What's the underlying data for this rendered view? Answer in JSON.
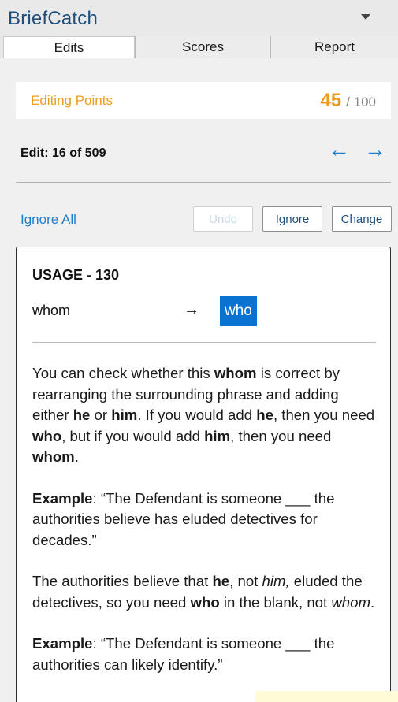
{
  "app": {
    "title": "BriefCatch"
  },
  "tabs": [
    {
      "label": "Edits",
      "active": true
    },
    {
      "label": "Scores",
      "active": false
    },
    {
      "label": "Report",
      "active": false
    }
  ],
  "points": {
    "label": "Editing Points",
    "current": "45",
    "total_text": "/ 100"
  },
  "edit_nav": {
    "counter": "Edit: 16 of 509",
    "prev_arrow": "←",
    "next_arrow": "→"
  },
  "actions": {
    "ignore_all": "Ignore All",
    "undo": "Undo",
    "ignore": "Ignore",
    "change": "Change"
  },
  "suggestion": {
    "rule": "USAGE - 130",
    "original": "whom",
    "arrow": "→",
    "replacement": "who",
    "paragraphs": [
      [
        {
          "t": "You can check whether this "
        },
        {
          "t": "whom",
          "b": true
        },
        {
          "t": " is correct by rearranging the surrounding phrase and adding either "
        },
        {
          "t": "he",
          "b": true
        },
        {
          "t": " or "
        },
        {
          "t": "him",
          "b": true
        },
        {
          "t": ". If you would add "
        },
        {
          "t": "he",
          "b": true
        },
        {
          "t": ", then you need "
        },
        {
          "t": "who",
          "b": true
        },
        {
          "t": ", but if you would add "
        },
        {
          "t": "him",
          "b": true
        },
        {
          "t": ", then you need "
        },
        {
          "t": "whom",
          "b": true
        },
        {
          "t": "."
        }
      ],
      [
        {
          "t": "Example",
          "b": true
        },
        {
          "t": ": “The Defendant is someone ___ the authorities believe has eluded detectives for decades.”"
        }
      ],
      [
        {
          "t": "The authorities believe that "
        },
        {
          "t": "he",
          "b": true
        },
        {
          "t": ", not "
        },
        {
          "t": "him,",
          "i": true
        },
        {
          "t": " eluded the detectives, so you need "
        },
        {
          "t": "who",
          "b": true
        },
        {
          "t": " in the blank, not "
        },
        {
          "t": "whom",
          "i": true
        },
        {
          "t": "."
        }
      ],
      [
        {
          "t": "Example",
          "b": true
        },
        {
          "t": ": “The Defendant is someone ___ the authorities can likely identify.”"
        }
      ]
    ]
  },
  "colors": {
    "accent_orange": "#ef9a1c",
    "link_blue": "#1f7fcf",
    "highlight_blue": "#0a73d1",
    "title_blue": "#1f4e79"
  }
}
